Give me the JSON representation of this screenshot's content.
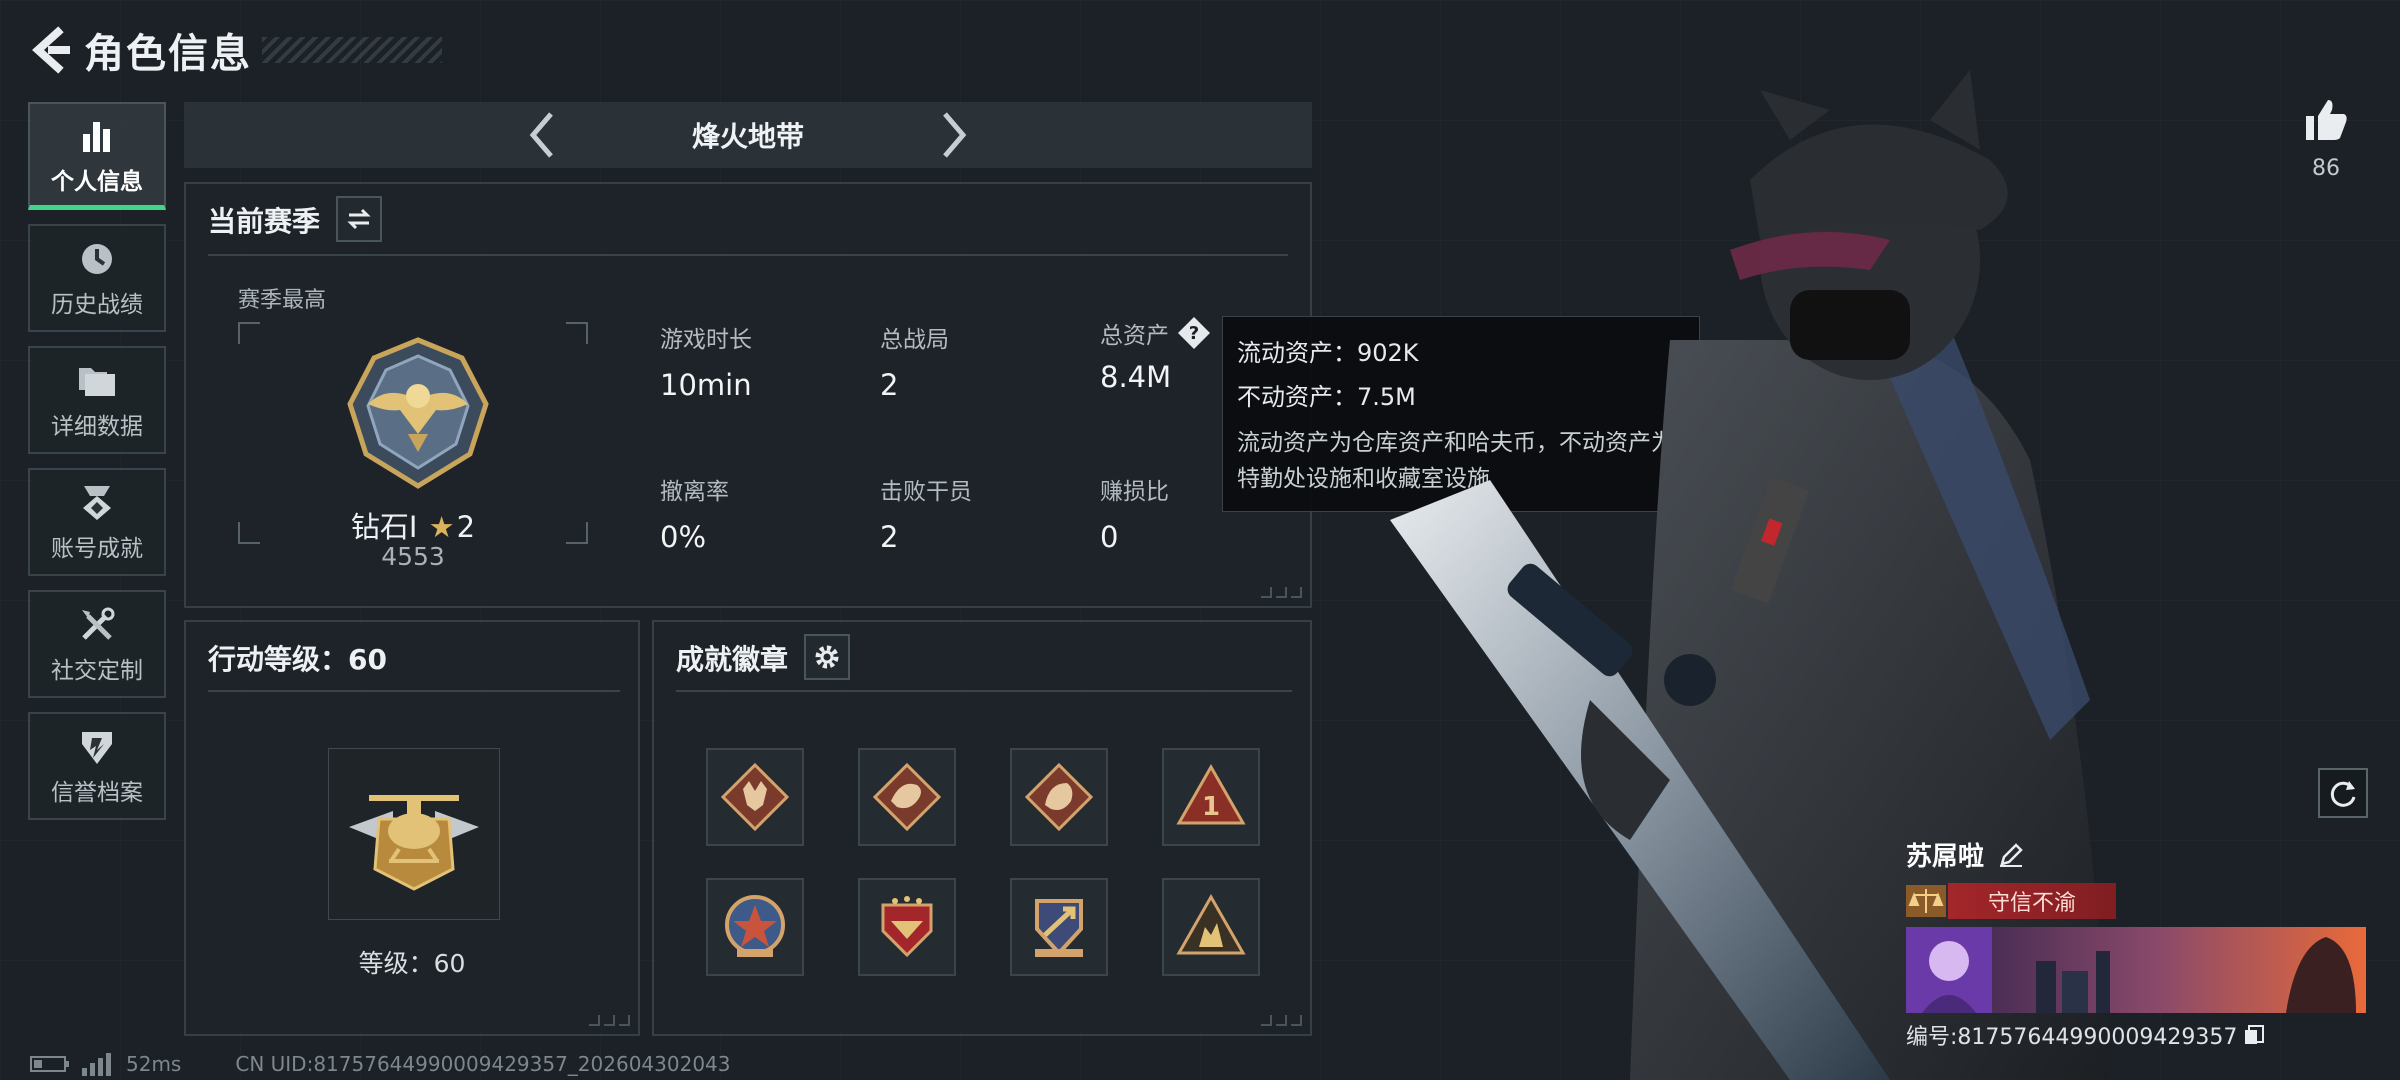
{
  "header": {
    "title": "角色信息"
  },
  "nav": {
    "items": [
      {
        "label": "个人信息",
        "icon": "bar-chart-icon",
        "active": true
      },
      {
        "label": "历史战绩",
        "icon": "clock-icon",
        "active": false
      },
      {
        "label": "详细数据",
        "icon": "folder-icon",
        "active": false
      },
      {
        "label": "账号成就",
        "icon": "medal-icon",
        "active": false
      },
      {
        "label": "社交定制",
        "icon": "tools-icon",
        "active": false
      },
      {
        "label": "信誉档案",
        "icon": "shield-icon",
        "active": false
      }
    ]
  },
  "mode": {
    "name": "烽火地带"
  },
  "season": {
    "title": "当前赛季",
    "best_label": "赛季最高",
    "rank_name": "钻石I",
    "rank_stars": "2",
    "rank_score": "4553",
    "stats": [
      {
        "label": "游戏时长",
        "value": "10min"
      },
      {
        "label": "总战局",
        "value": "2"
      },
      {
        "label": "总资产",
        "value": "8.4M",
        "has_help": true
      },
      {
        "label": "撤离率",
        "value": "0%"
      },
      {
        "label": "击败干员",
        "value": "2"
      },
      {
        "label": "赚损比",
        "value": "0"
      }
    ]
  },
  "tooltip": {
    "line1": "流动资产：902K",
    "line2": "不动资产：7.5M",
    "desc": "流动资产为仓库资产和哈夫币，不动资产为特勤处设施和收藏室设施"
  },
  "level": {
    "title": "行动等级：60",
    "text": "等级：60"
  },
  "badges": {
    "title": "成就徽章",
    "items": [
      "wolf-badge",
      "dragon-badge",
      "dragon-badge",
      "rank-one-badge",
      "star-shield-badge",
      "wing-badge",
      "arrow-shield-badge",
      "soldiers-badge"
    ]
  },
  "likes": {
    "count": "86"
  },
  "player": {
    "name": "苏屌啦",
    "credit_label": "守信不渝",
    "id_text": "编号:8175764499000942935​7"
  },
  "status": {
    "ping": "52ms",
    "uid": "CN UID:8175764499000942935​7_202604302043"
  },
  "colors": {
    "accent": "#3fd68a",
    "credit_red": "#a3262a",
    "panel_border": "#363f46"
  }
}
